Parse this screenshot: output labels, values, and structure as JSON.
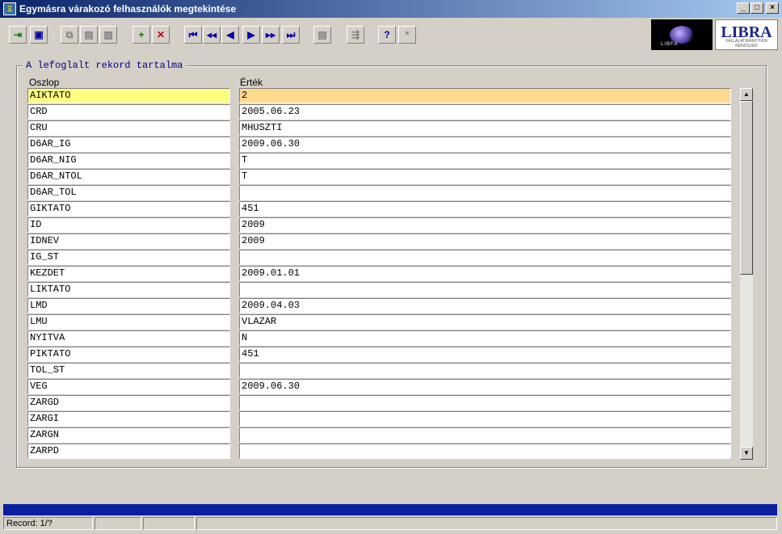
{
  "window": {
    "title": "Egymásra várakozó felhasználók megtekintése",
    "icon_name": "app-icon",
    "controls": [
      "_",
      "□",
      "×"
    ]
  },
  "toolbar": {
    "buttons": [
      {
        "name": "exit-icon",
        "glyph": "⇥",
        "color": "green"
      },
      {
        "name": "save-icon",
        "glyph": "▣",
        "color": "blue"
      },
      {
        "name": "copy-icon",
        "glyph": "⧉",
        "color": "gray"
      },
      {
        "name": "paste-icon",
        "glyph": "▤",
        "color": "gray"
      },
      {
        "name": "delete-copy-icon",
        "glyph": "▨",
        "color": "gray"
      },
      {
        "name": "add-record-icon",
        "glyph": "+",
        "color": "green"
      },
      {
        "name": "delete-record-icon",
        "glyph": "✕",
        "color": "red"
      },
      {
        "name": "first-record-icon",
        "glyph": "⏮",
        "color": "blue"
      },
      {
        "name": "previous-page-icon",
        "glyph": "◀◀",
        "color": "blue"
      },
      {
        "name": "previous-record-icon",
        "glyph": "◀",
        "color": "blue"
      },
      {
        "name": "next-record-icon",
        "glyph": "▶",
        "color": "blue"
      },
      {
        "name": "next-page-icon",
        "glyph": "▶▶",
        "color": "blue"
      },
      {
        "name": "last-record-icon",
        "glyph": "⏭",
        "color": "blue"
      },
      {
        "name": "print-icon",
        "glyph": "▤",
        "color": "gray"
      },
      {
        "name": "search-icon",
        "glyph": "⇶",
        "color": "gray"
      },
      {
        "name": "help-icon",
        "glyph": "?",
        "color": "blue"
      },
      {
        "name": "context-help-icon",
        "glyph": "*",
        "color": "gray"
      }
    ],
    "logo_left_text": "LIBFA",
    "logo_right_text": "LIBRA",
    "logo_right_sub": "VÁLLALATIRÁNYÍTÁSI RENDSZER"
  },
  "group": {
    "legend": "A lefoglalt rekord tartalma",
    "col_name_header": "Oszlop",
    "col_value_header": "Érték"
  },
  "rows": [
    {
      "name": "AIKTATO",
      "value": "2",
      "selected": true
    },
    {
      "name": "CRD",
      "value": "2005.06.23"
    },
    {
      "name": "CRU",
      "value": "MHUSZTI"
    },
    {
      "name": "D6AR_IG",
      "value": "2009.06.30"
    },
    {
      "name": "D6AR_NIG",
      "value": "T"
    },
    {
      "name": "D6AR_NTOL",
      "value": "T"
    },
    {
      "name": "D6AR_TOL",
      "value": ""
    },
    {
      "name": "GIKTATO",
      "value": "451"
    },
    {
      "name": "ID",
      "value": "2009"
    },
    {
      "name": "IDNEV",
      "value": "2009"
    },
    {
      "name": "IG_ST",
      "value": ""
    },
    {
      "name": "KEZDET",
      "value": "2009.01.01"
    },
    {
      "name": "LIKTATO",
      "value": ""
    },
    {
      "name": "LMD",
      "value": "2009.04.03"
    },
    {
      "name": "LMU",
      "value": "VLAZAR"
    },
    {
      "name": "NYITVA",
      "value": "N"
    },
    {
      "name": "PIKTATO",
      "value": "451"
    },
    {
      "name": "TOL_ST",
      "value": ""
    },
    {
      "name": "VEG",
      "value": "2009.06.30"
    },
    {
      "name": "ZARGD",
      "value": ""
    },
    {
      "name": "ZARGI",
      "value": ""
    },
    {
      "name": "ZARGN",
      "value": ""
    },
    {
      "name": "ZARPD",
      "value": ""
    }
  ],
  "status": {
    "record": "Record: 1/?"
  }
}
